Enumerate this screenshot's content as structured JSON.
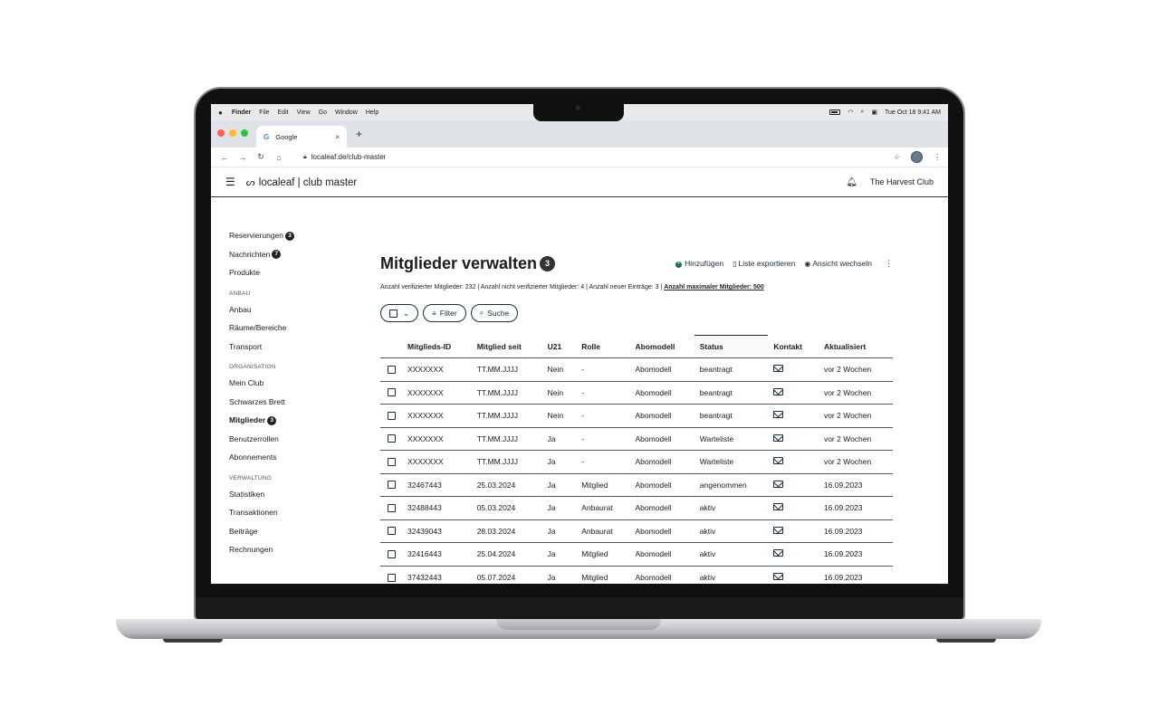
{
  "menubar": {
    "apple": "",
    "items": [
      "Finder",
      "File",
      "Edit",
      "View",
      "Go",
      "Window",
      "Help"
    ],
    "datetime": "Tue Oct 18  9:41 AM"
  },
  "browser": {
    "tab_title": "Google",
    "tab_favicon": "G",
    "tab_close": "×",
    "new_tab": "+",
    "url": "localeaf.de/club-master"
  },
  "app": {
    "brand": "localeaf | club master",
    "club_name": "The Harvest Club"
  },
  "sidebar": {
    "top": [
      {
        "label": "Reservierungen",
        "badge": "3"
      },
      {
        "label": "Nachrichten",
        "badge": "7"
      },
      {
        "label": "Produkte",
        "badge": ""
      }
    ],
    "sections": [
      {
        "title": "ANBAU",
        "items": [
          {
            "label": "Anbau",
            "badge": ""
          },
          {
            "label": "Räume/Bereiche",
            "badge": ""
          },
          {
            "label": "Transport",
            "badge": ""
          }
        ]
      },
      {
        "title": "ORGANISATION",
        "items": [
          {
            "label": "Mein Club",
            "badge": ""
          },
          {
            "label": "Schwarzes Brett",
            "badge": ""
          },
          {
            "label": "Mitglieder",
            "badge": "3",
            "active": true
          },
          {
            "label": "Benutzerrollen",
            "badge": ""
          },
          {
            "label": "Abonnements",
            "badge": ""
          }
        ]
      },
      {
        "title": "VERWALTUNG",
        "items": [
          {
            "label": "Statistiken",
            "badge": ""
          },
          {
            "label": "Transaktionen",
            "badge": ""
          },
          {
            "label": "Beiträge",
            "badge": ""
          },
          {
            "label": "Rechnungen",
            "badge": ""
          }
        ]
      }
    ]
  },
  "main": {
    "title": "Mitglieder verwalten",
    "title_badge": "3",
    "actions": {
      "add": "Hinzufügen",
      "export": "Liste exportieren",
      "switch_view": "Ansicht wechseln"
    },
    "stats_text": "Anzahl verifizierter Mitglieder: 232 | Anzahl nicht verifizierter Mitglieder: 4 | Anzahl neuer Einträge: 3 | ",
    "stats_max": "Anzahl maximaler Mitglieder: 500",
    "toolbar": {
      "filter": "Filter",
      "search": "Suche"
    },
    "columns": [
      "Mitglieds-ID",
      "Mitglied seit",
      "U21",
      "Rolle",
      "Abomodell",
      "Status",
      "Kontakt",
      "Aktualisiert"
    ],
    "rows": [
      [
        "XXXXXXX",
        "TT.MM.JJJJ",
        "Nein",
        "-",
        "Abomodell",
        "beantragt",
        "vor 2 Wochen"
      ],
      [
        "XXXXXXX",
        "TT.MM.JJJJ",
        "Nein",
        "-",
        "Abomodell",
        "beantragt",
        "vor 2 Wochen"
      ],
      [
        "XXXXXXX",
        "TT.MM.JJJJ",
        "Nein",
        "-",
        "Abomodell",
        "beantragt",
        "vor 2 Wochen"
      ],
      [
        "XXXXXXX",
        "TT.MM.JJJJ",
        "Ja",
        "-",
        "Abomodell",
        "Warteliste",
        "vor 2 Wochen"
      ],
      [
        "XXXXXXX",
        "TT.MM.JJJJ",
        "Ja",
        "-",
        "Abomodell",
        "Warteliste",
        "vor 2 Wochen"
      ],
      [
        "32467443",
        "25.03.2024",
        "Ja",
        "Mitglied",
        "Abomodell",
        "angenommen",
        "16.09.2023"
      ],
      [
        "32488443",
        "05.03.2024",
        "Ja",
        "Anbaurat",
        "Abomodell",
        "aktiv",
        "16.09.2023"
      ],
      [
        "32439043",
        "28.03.2024",
        "Ja",
        "Anbaurat",
        "Abomodell",
        "aktiv",
        "16.09.2023"
      ],
      [
        "32416443",
        "25.04.2024",
        "Ja",
        "Mitglied",
        "Abomodell",
        "aktiv",
        "16.09.2023"
      ],
      [
        "37432443",
        "05.07.2024",
        "Ja",
        "Mitglied",
        "Abomodell",
        "aktiv",
        "16.09.2023"
      ]
    ]
  },
  "colors": {
    "accent_dark": "#1c2d3e",
    "add_green": "#1f6b4f",
    "header_rule": "#2c3a2f"
  }
}
